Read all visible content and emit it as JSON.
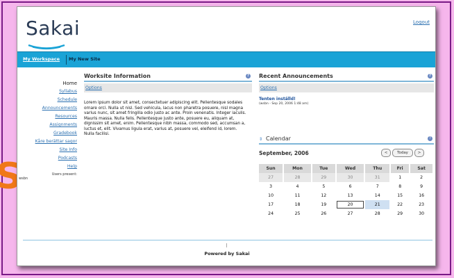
{
  "overlay_letter": "S",
  "header": {
    "logo": "Sakai",
    "logout": "Logout"
  },
  "sitebar": {
    "my_workspace": "My Workspace",
    "new_site": "My New Site"
  },
  "nav": {
    "home": "Home",
    "items": [
      "Syllabus",
      "Schedule",
      "Announcements",
      "Resources",
      "Assignments",
      "Gradebook",
      "Kåre berättar sagor",
      "Site Info",
      "Podcasts",
      "Help"
    ],
    "users_present_label": "Users present:",
    "user": "wsbn"
  },
  "worksite": {
    "title": "Worksite Information",
    "options": "Options",
    "text": "Lorem ipsum dolor sit amet, consectetuer adipiscing elit. Pellentesque sodales ornare orci. Nulla ut nisl. Sed vehicula, lacus non pharetra posuere, nisl magna varius nunc, sit amet fringilla odio justo ac ante. Proin venenatis. Integer iaculis. Mauris massa. Nulla felis. Pellentesque justo ante, posuere eu, aliquam at, dignissim sit amet, enim. Pellentesque nibh massa, commodo sed, accumsan a, luctus et, elit. Vivamus ligula erat, varius at, posuere vel, eleifend id, lorem. Nulla facilisi."
  },
  "announcements": {
    "title": "Recent Announcements",
    "options": "Options",
    "item_title": "Tenten inställd!",
    "item_meta": "(wsbn - Sep 20, 2006 1:48 am)"
  },
  "calendar": {
    "title": "Calendar",
    "month": "September, 2006",
    "prev": "<",
    "today": "Today",
    "next": ">",
    "weekdays": [
      "Sun",
      "Mon",
      "Tue",
      "Wed",
      "Thu",
      "Fri",
      "Sat"
    ],
    "weeks": [
      [
        "27",
        "28",
        "29",
        "30",
        "31",
        "1",
        "2"
      ],
      [
        "3",
        "4",
        "5",
        "6",
        "7",
        "8",
        "9"
      ],
      [
        "10",
        "11",
        "12",
        "13",
        "14",
        "15",
        "16"
      ],
      [
        "17",
        "18",
        "19",
        "20",
        "21",
        "22",
        "23"
      ],
      [
        "24",
        "25",
        "26",
        "27",
        "28",
        "29",
        "30"
      ]
    ],
    "today_date": "20",
    "highlight_date": "21"
  },
  "footer": {
    "powered": "Powered by Sakai"
  }
}
